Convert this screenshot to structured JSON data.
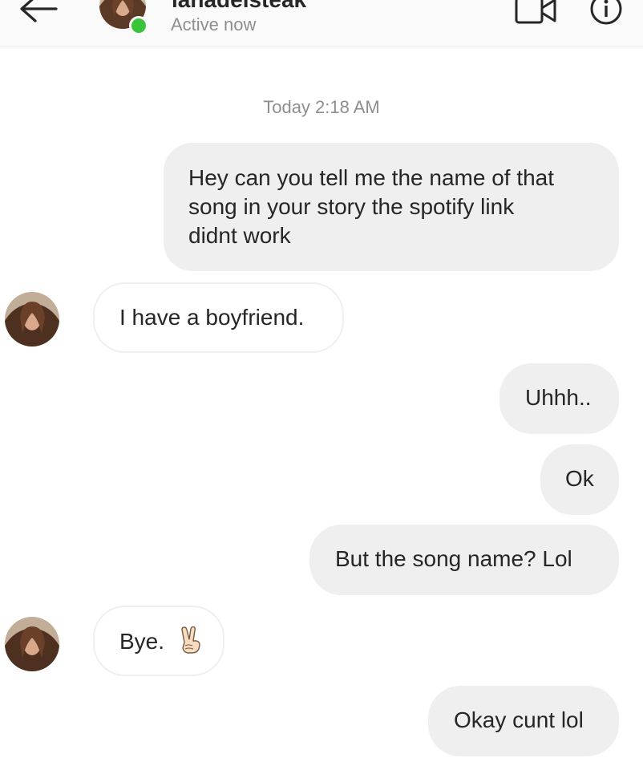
{
  "header": {
    "username": "lanadelsteak",
    "status": "Active now",
    "online_color": "#39c439",
    "icons": {
      "back": "arrow-left-icon",
      "video": "video-camera-icon",
      "info": "info-icon"
    }
  },
  "thread": {
    "timestamp": "Today 2:18 AM",
    "messages": [
      {
        "sender": "me",
        "text_lines": [
          "Hey can you tell me the name of that",
          "song in your story the spotify link",
          "didnt work"
        ]
      },
      {
        "sender": "them",
        "text": "I have a boyfriend."
      },
      {
        "sender": "me",
        "text": "Uhhh.."
      },
      {
        "sender": "me",
        "text": "Ok"
      },
      {
        "sender": "me",
        "text": "But the song name? Lol"
      },
      {
        "sender": "them",
        "text": "Bye.",
        "emoji": "victory-hand-emoji"
      },
      {
        "sender": "me",
        "text": "Okay cunt lol"
      }
    ]
  },
  "colors": {
    "outgoing_bubble": "#efefef",
    "incoming_border": "#efefef",
    "text": "#262626",
    "secondary_text": "#8e8e8e"
  }
}
